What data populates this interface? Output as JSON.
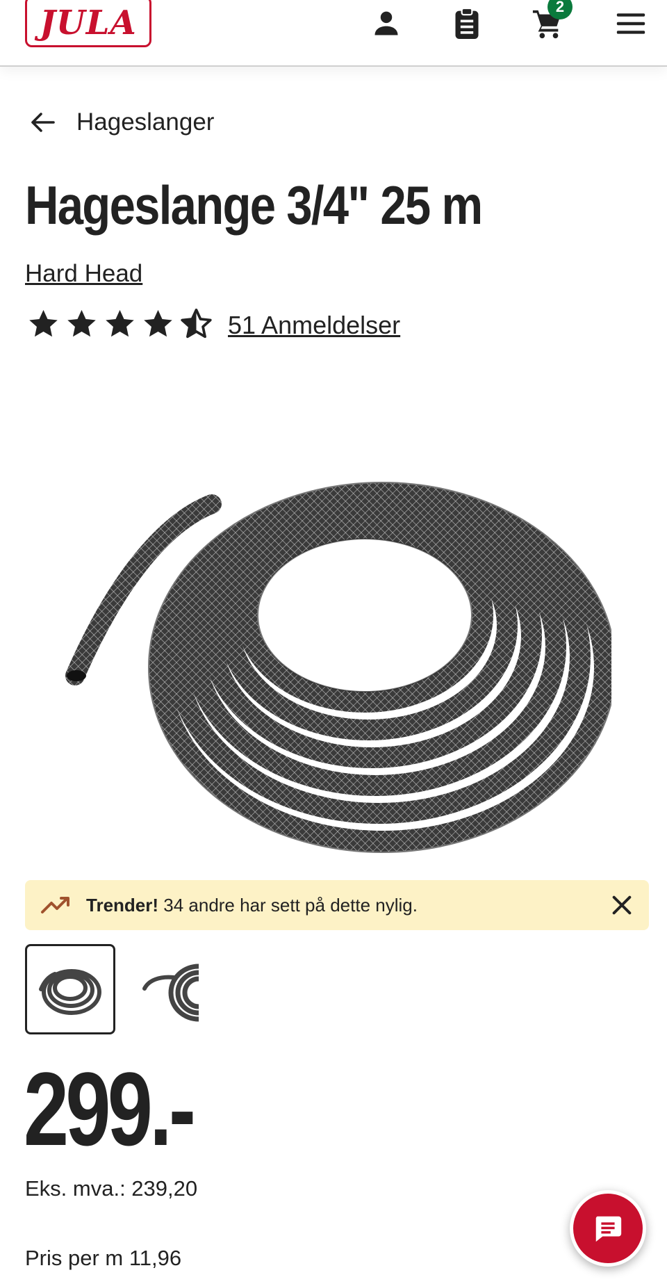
{
  "header": {
    "logo_text": "JULA",
    "cart_count": "2",
    "icons": [
      "account-icon",
      "shopping-list-icon",
      "cart-icon",
      "menu-icon"
    ]
  },
  "breadcrumb": {
    "label": "Hageslanger"
  },
  "product": {
    "title": "Hageslange 3/4\" 25 m",
    "brand": "Hard Head",
    "rating": 4.5,
    "rating_max": 5,
    "reviews_label": "51 Anmeldelser"
  },
  "trend_banner": {
    "bold": "Trender!",
    "text": " 34 andre har sett på dette nylig."
  },
  "price": {
    "amount": "299.-",
    "ex_vat": "Eks. mva.: 239,20",
    "per_unit": "Pris per m 11,96"
  },
  "colors": {
    "brand_red": "#c8102e",
    "badge_green": "#0a7a3c",
    "banner_yellow": "#fdf2c6"
  }
}
